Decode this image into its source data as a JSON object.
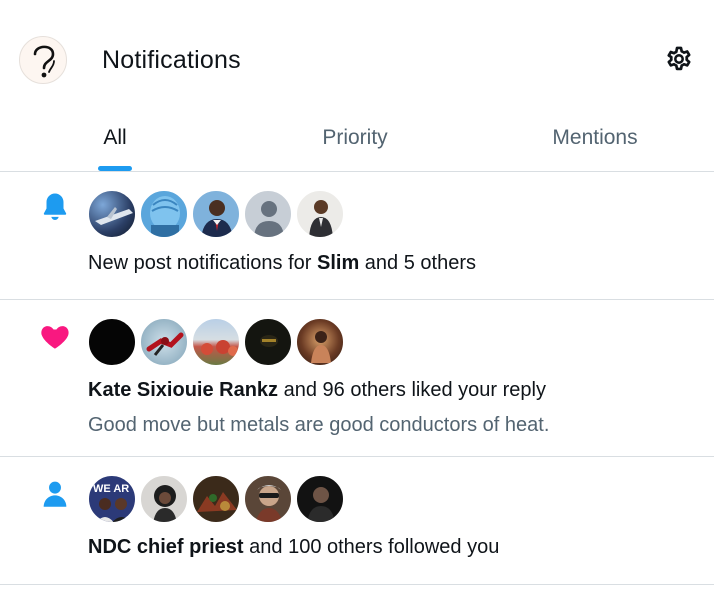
{
  "header": {
    "title": "Notifications",
    "avatar_icon": "question-mark-avatar",
    "settings_icon": "gear-icon"
  },
  "tabs": [
    {
      "label": "All",
      "active": true
    },
    {
      "label": "Priority",
      "active": false
    },
    {
      "label": "Mentions",
      "active": false
    }
  ],
  "notifications": [
    {
      "type": "new-post",
      "icon": "bell-icon",
      "icon_color": "#1d9bf0",
      "actor": "Slim",
      "prefix": "New post notifications for ",
      "suffix": " and 5 others",
      "avatar_count": 5
    },
    {
      "type": "like",
      "icon": "heart-icon",
      "icon_color": "#f91880",
      "actor": "Kate Sixiouie Rankz",
      "suffix": " and 96 others liked your reply",
      "quote": "Good move but metals are good conductors of heat.",
      "avatar_count": 5
    },
    {
      "type": "follow",
      "icon": "person-icon",
      "icon_color": "#1d9bf0",
      "actor": "NDC chief priest",
      "suffix": " and 100 others followed you",
      "avatar_count": 5
    }
  ],
  "colors": {
    "accent": "#1d9bf0",
    "like": "#f91880",
    "text": "#0f1419",
    "muted": "#536471",
    "divider": "#d9dee2"
  }
}
